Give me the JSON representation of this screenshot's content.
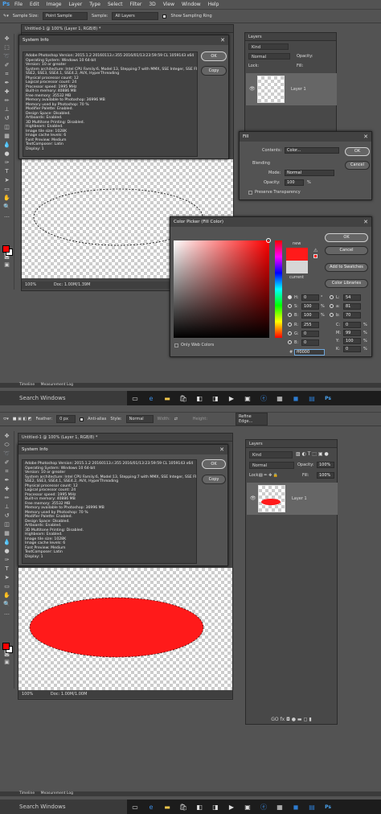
{
  "app": {
    "logo": "Ps"
  },
  "menu": [
    "File",
    "Edit",
    "Image",
    "Layer",
    "Type",
    "Select",
    "Filter",
    "3D",
    "View",
    "Window",
    "Help"
  ],
  "top_options": {
    "sample_size_label": "Sample Size:",
    "sample_size_value": "Point Sample",
    "sample_label": "Sample:",
    "sample_value": "All Layers",
    "show_ring_label": "Show Sampling Ring"
  },
  "bottom_options": {
    "feather_label": "Feather:",
    "feather_value": "0 px",
    "antialias_label": "Anti-alias",
    "style_label": "Style:",
    "style_value": "Normal",
    "width_label": "Width:",
    "height_label": "Height:",
    "refine_edge": "Refine Edge..."
  },
  "document": {
    "tab_title": "Untitled-1 @ 100% (Layer 1, RGB/8) *",
    "zoom": "100%",
    "doc_size": "Doc: 1.00M/1.39M",
    "doc_size_bottom": "Doc: 1.00M/1.00M"
  },
  "system_info": {
    "title": "System Info",
    "ok": "OK",
    "copy": "Copy",
    "lines": [
      "Adobe Photoshop Version: 2015.1.2 20160113.r.355 2016/01/13:23:59:59 CL 1059143  x64",
      "Operating System: Windows 10 64-bit",
      "Version: 10 or greater",
      "System architecture: Intel CPU Family:6, Model:13, Stepping:7 with MMX, SSE Integer, SSE FP,",
      "SSE2, SSE3, SSE4.1, SSE4.2, AVX, HyperThreading",
      "Physical processor count: 12",
      "Logical processor count: 24",
      "Processor speed: 1995 MHz",
      "Built-in memory: 40886 MB",
      "Free memory: 35532 MB",
      "Memory available to Photoshop: 36996 MB",
      "Memory used by Photoshop: 70 %",
      "Modifier Palette: Enabled.",
      "Design Space: Disabled.",
      "Artboards: Enabled.",
      "3D Multitone Printing: Disabled.",
      "Highbeam: Enabled.",
      "Image tile size: 1028K",
      "Image cache levels: 6",
      "Font Preview: Medium",
      "TextComposer: Latin",
      "Display: 1"
    ]
  },
  "layers": {
    "title": "Layers",
    "kind": "Kind",
    "blend": "Normal",
    "opacity_label": "Opacity:",
    "opacity_value": "100%",
    "lock_label": "Lock:",
    "fill_label": "Fill:",
    "fill_value": "100%",
    "layer_name": "Layer 1",
    "footer_icons": "GO  fx  ◘  ●  ▬  ◻  ▮"
  },
  "fill_dialog": {
    "title": "Fill",
    "contents_label": "Contents:",
    "contents_value": "Color...",
    "blending_label": "Blending",
    "mode_label": "Mode:",
    "mode_value": "Normal",
    "opacity_label": "Opacity:",
    "opacity_value": "100",
    "opacity_unit": "%",
    "preserve_label": "Preserve Transparency",
    "ok": "OK",
    "cancel": "Cancel"
  },
  "color_picker": {
    "title": "Color Picker (Fill Color)",
    "ok": "OK",
    "cancel": "Cancel",
    "add_swatches": "Add to Swatches",
    "color_libraries": "Color Libraries",
    "new_label": "new",
    "current_label": "current",
    "only_web": "Only Web Colors",
    "H": "0",
    "S": "100",
    "B": "100",
    "R": "255",
    "G": "0",
    "Bb": "0",
    "L": "54",
    "a": "81",
    "b": "70",
    "C": "0",
    "M": "99",
    "Y": "100",
    "K": "0",
    "hex": "ff0000",
    "deg": "°",
    "pct": "%"
  },
  "timeline": {
    "timeline": "Timeline",
    "measurement_log": "Measurement Log"
  },
  "taskbar": {
    "search": "Search Windows"
  },
  "colors": {
    "fill": "#ff1a1a",
    "current": "#d6d6d6"
  }
}
